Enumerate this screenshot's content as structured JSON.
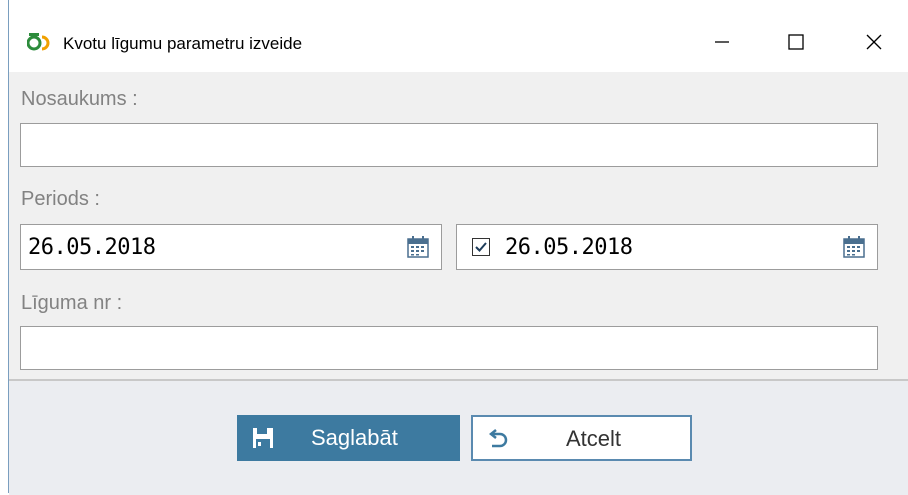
{
  "window": {
    "title": "Kvotu līgumu parametru izveide",
    "buttons": {
      "minimize": "—",
      "maximize": "☐",
      "close": "✕"
    }
  },
  "form": {
    "name_label": "Nosaukums :",
    "name_value": "",
    "period_label": "Periods :",
    "date_from": "26.05.2018",
    "date_to": "26.05.2018",
    "date_to_checked": true,
    "contract_label": "Līguma nr :",
    "contract_value": ""
  },
  "actions": {
    "save_label": "Saglabāt",
    "cancel_label": "Atcelt"
  },
  "colors": {
    "accent": "#3d7aa0",
    "body_bg": "#f0f0f0"
  },
  "icons": {
    "app": "app-logo-icon",
    "calendar": "calendar-icon",
    "save": "floppy-disk-icon",
    "cancel": "undo-arrow-icon",
    "checkbox": "checkmark-icon"
  }
}
